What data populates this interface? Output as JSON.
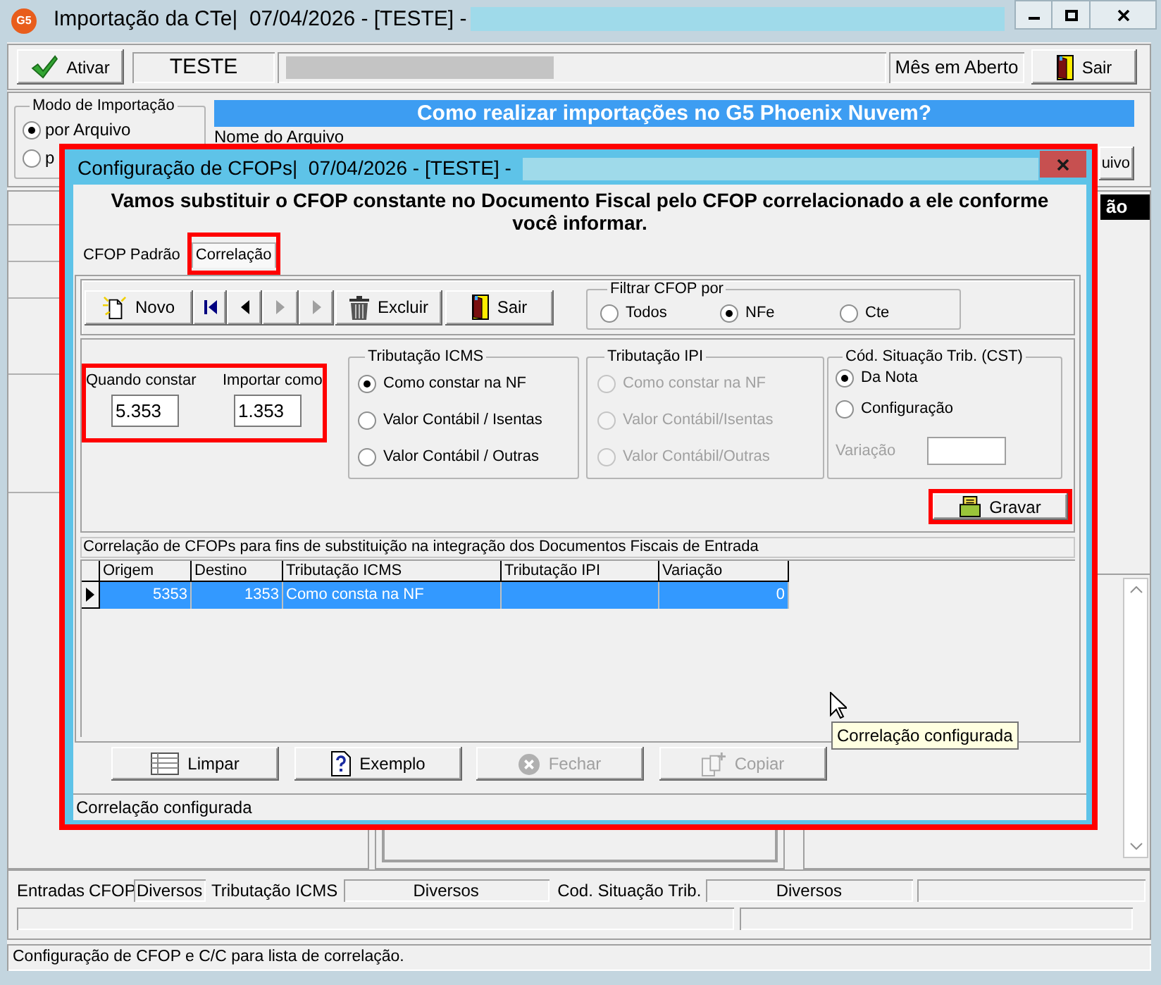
{
  "window": {
    "icon_text": "G5",
    "title": "Importação da CTe|  07/04/2026 - [TESTE] -"
  },
  "toolbar": {
    "activate_button": "Ativar",
    "company": "TESTE",
    "period": "Mês em Aberto",
    "exit_button": "Sair"
  },
  "import_mode": {
    "title": "Modo de Importação",
    "options": [
      {
        "label": "por Arquivo",
        "selected": true
      },
      {
        "label": "p",
        "selected": false
      }
    ]
  },
  "help_banner": "Como realizar importações no G5 Phoenix Nuvem?",
  "file": {
    "label": "Nome do Arquivo",
    "button": "uivo"
  },
  "right_panel": {
    "header": "ão"
  },
  "dialog": {
    "highlighted": true,
    "title": "Configuração de CFOPs|  07/04/2026 - [TESTE] -",
    "intro": "Vamos substituir o CFOP constante no Documento Fiscal pelo CFOP correlacionado a ele conforme você informar.",
    "tabs": [
      {
        "label": "CFOP Padrão",
        "selected": false,
        "highlighted": false
      },
      {
        "label": "Correlação",
        "selected": true,
        "highlighted": true
      }
    ],
    "toolbar": [
      {
        "kind": "new",
        "label": "Novo",
        "disabled": false
      },
      {
        "kind": "first",
        "disabled": false
      },
      {
        "kind": "previous",
        "disabled": false
      },
      {
        "kind": "next",
        "disabled": true
      },
      {
        "kind": "last",
        "disabled": true
      },
      {
        "kind": "delete",
        "label": "Excluir",
        "disabled": false
      },
      {
        "kind": "exit",
        "label": "Sair",
        "disabled": false
      }
    ],
    "filter": {
      "title": "Filtrar CFOP por",
      "options": [
        {
          "label": "Todos",
          "selected": false
        },
        {
          "label": "NFe",
          "selected": true
        },
        {
          "label": "Cte",
          "selected": false
        }
      ]
    },
    "correlation": {
      "highlighted": true,
      "source": {
        "label": "Quando constar",
        "value": "5.353"
      },
      "target": {
        "label": "Importar como",
        "value": "1.353"
      }
    },
    "icms": {
      "title": "Tributação ICMS",
      "options": [
        {
          "label": "Como constar na NF",
          "selected": true,
          "disabled": false
        },
        {
          "label": "Valor Contábil / Isentas",
          "selected": false,
          "disabled": false
        },
        {
          "label": "Valor Contábil / Outras",
          "selected": false,
          "disabled": false
        }
      ]
    },
    "ipi": {
      "title": "Tributação IPI",
      "options": [
        {
          "label": "Como constar na NF",
          "selected": false,
          "disabled": true
        },
        {
          "label": "Valor Contábil/Isentas",
          "selected": false,
          "disabled": true
        },
        {
          "label": "Valor Contábil/Outras",
          "selected": false,
          "disabled": true
        }
      ]
    },
    "cst": {
      "title": "Cód. Situação Trib. (CST)",
      "options": [
        {
          "label": "Da Nota",
          "selected": true
        },
        {
          "label": "Configuração",
          "selected": false
        }
      ],
      "variation": {
        "label": "Variação",
        "disabled": true
      }
    },
    "save_button": {
      "label": "Gravar",
      "highlighted": true
    },
    "grid": {
      "caption": "Correlação de CFOPs para fins de substituição na integração dos Documentos Fiscais de Entrada",
      "columns": [
        "Origem",
        "Destino",
        "Tributação ICMS",
        "Tributação IPI",
        "Variação"
      ],
      "rows": [
        {
          "selected": true,
          "origin": "5353",
          "target": "1353",
          "icms": "Como consta na NF",
          "variation": "0"
        }
      ]
    },
    "buttons": [
      {
        "kind": "clear",
        "label": "Limpar",
        "disabled": false
      },
      {
        "kind": "example",
        "label": "Exemplo",
        "disabled": false
      },
      {
        "kind": "close",
        "label": "Fechar",
        "disabled": true
      },
      {
        "kind": "copy",
        "label": "Copiar",
        "disabled": true
      }
    ],
    "status": "Correlação configurada"
  },
  "tooltip": "Correlação configurada",
  "summary": {
    "entries_label": "Entradas",
    "cfop_label": "CFOP",
    "cfop_value": "Diversos",
    "icms_label": "Tributação ICMS",
    "icms_value": "Diversos",
    "cst_label": "Cod. Situação Trib.",
    "cst_value": "Diversos"
  },
  "status_bar": "Configuração de CFOP e C/C para lista de correlação."
}
